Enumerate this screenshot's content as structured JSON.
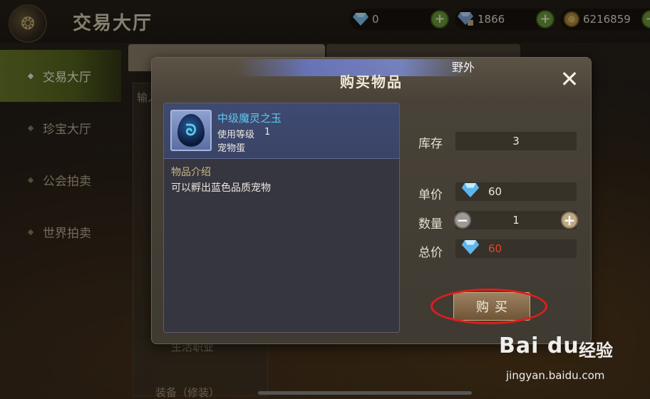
{
  "top_bar": {
    "title": "交易大厅",
    "currencies": [
      {
        "icon": "diamond-icon",
        "value": "0"
      },
      {
        "icon": "bound-diamond-icon",
        "value": "1866"
      },
      {
        "icon": "gold-coin-icon",
        "value": "6216859"
      }
    ],
    "plus_label": "+"
  },
  "sidebar": {
    "items": [
      {
        "label": "交易大厅",
        "active": true
      },
      {
        "label": "珍宝大厅",
        "active": false
      },
      {
        "label": "公会拍卖",
        "active": false
      },
      {
        "label": "世界拍卖",
        "active": false
      }
    ]
  },
  "background": {
    "input_label": "输入",
    "filter_label": "生活职业",
    "filter2_label": "装备（修装）",
    "tab_right": "野外",
    "row_hint": "中级魔灵之玉"
  },
  "modal": {
    "banner_text": "野外",
    "title": "购买物品",
    "close_label": "✕",
    "item": {
      "name": "中级魔灵之玉",
      "level_label": "使用等级",
      "level_value": "1",
      "type": "宠物蛋",
      "desc_label": "物品介绍",
      "desc_text": "可以孵出蓝色品质宠物"
    },
    "stock_label": "库存",
    "stock_value": "3",
    "unit_price_label": "单价",
    "unit_price_value": "60",
    "quantity_label": "数量",
    "quantity_value": "1",
    "minus_label": "−",
    "plus_label": "+",
    "total_label": "总价",
    "total_value": "60",
    "buy_label": "购买"
  },
  "watermark": {
    "logo": "Bai du",
    "cn": "经验",
    "url": "jingyan.baidu.com"
  },
  "colors": {
    "accent_green": "#6d9a3a",
    "item_name_blue": "#5ec8ef",
    "total_red": "#e4442e",
    "highlight_red": "#e21c1c"
  }
}
